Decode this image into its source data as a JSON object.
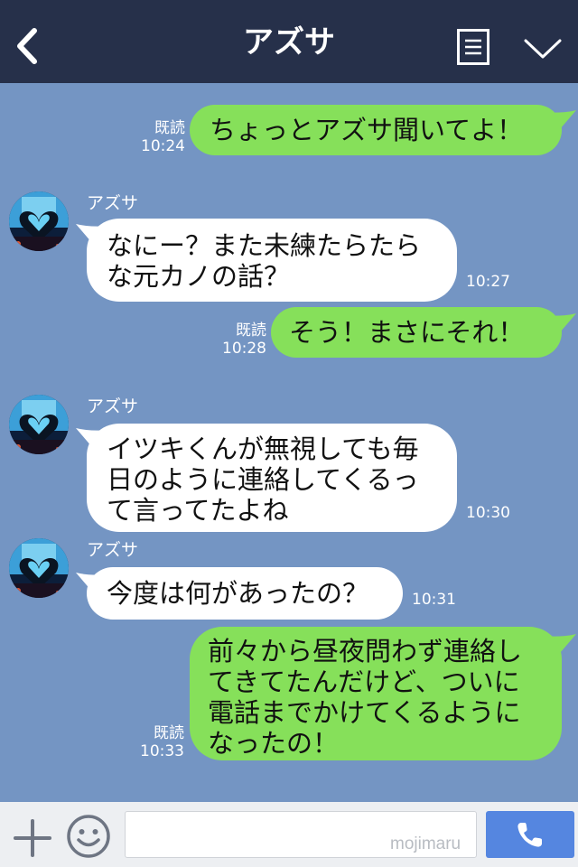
{
  "header": {
    "title": "アズサ"
  },
  "messages": [
    {
      "side": "sent",
      "read_label": "既読",
      "time": "10:24",
      "text": "ちょっとアズサ聞いてよ！"
    },
    {
      "side": "received",
      "sender": "アズサ",
      "time": "10:27",
      "text": "なにー？また未練たらたら\nな元カノの話？"
    },
    {
      "side": "sent",
      "read_label": "既読",
      "time": "10:28",
      "text": "そう！まさにそれ！"
    },
    {
      "side": "received",
      "sender": "アズサ",
      "time": "10:30",
      "text": "イツキくんが無視しても毎\n日のように連絡してくるっ\nて言ってたよね"
    },
    {
      "side": "received",
      "sender": "アズサ",
      "time": "10:31",
      "text": "今度は何があったの？"
    },
    {
      "side": "sent",
      "read_label": "既読",
      "time": "10:33",
      "text": "前々から昼夜問わず連絡し\nてきてたんだけど、ついに\n電話までかけてくるように\nなったの！"
    }
  ],
  "bottom_bar": {
    "input_value": "",
    "watermark": "mojimaru"
  },
  "colors": {
    "header_bg": "#26304a",
    "chat_bg": "#7495c3",
    "sent_bubble": "#86e05a",
    "received_bubble": "#ffffff",
    "call_button": "#5586e0"
  },
  "icons": {
    "back": "chevron-left-icon",
    "menu": "menu-icon",
    "dropdown": "chevron-down-icon",
    "plus": "plus-icon",
    "emoji": "smiley-icon",
    "call": "phone-icon"
  }
}
